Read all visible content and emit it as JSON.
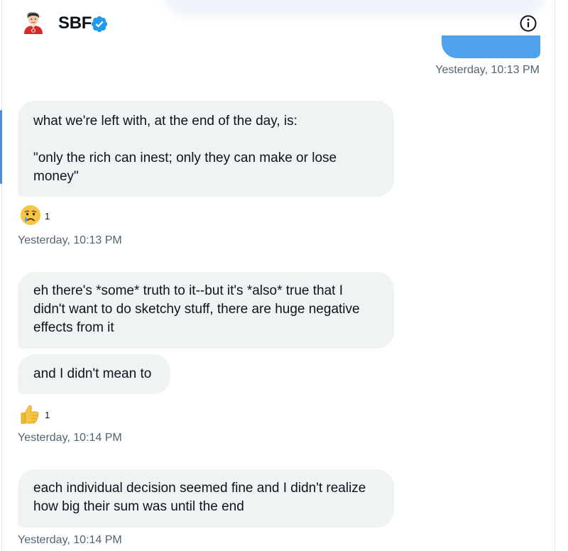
{
  "header": {
    "contact_name": "SBF",
    "avatar_icon": "person-avatar-icon",
    "verified_icon": "verified-badge-icon",
    "info_icon": "info-icon",
    "accent_color": "#1d9bf0"
  },
  "sent": {
    "timestamp": "Yesterday, 10:13 PM",
    "bubble_color": "#4fa3ec"
  },
  "messages": [
    {
      "text": "what we're left with, at the end of the day, is:\n\n\"only the rich can inest; only they can make or lose money\""
    },
    {
      "text": "eh there's *some* truth to it--but it's *also* true that I didn't want to do sketchy stuff, there are huge negative effects from it"
    },
    {
      "text": "and I didn't mean to"
    },
    {
      "text": "each individual decision seemed fine and I didn't realize how big their sum was until the end"
    }
  ],
  "reactions": [
    {
      "emoji": "crying-face-icon",
      "count": "1"
    },
    {
      "emoji": "thumbs-up-icon",
      "count": "1"
    }
  ],
  "timestamps": [
    "Yesterday, 10:13 PM",
    "Yesterday, 10:14 PM",
    "Yesterday, 10:14 PM"
  ]
}
